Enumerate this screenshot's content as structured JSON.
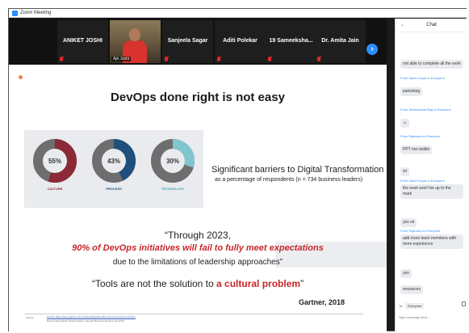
{
  "window": {
    "title": "Zoom Meeting"
  },
  "gallery": {
    "participants": [
      {
        "name": "ANIKET JOSHI"
      },
      {
        "name": "",
        "video_label": "Ajit Joshi"
      },
      {
        "name": "Sanjeela Sagar"
      },
      {
        "name": "Aditi Polekar"
      },
      {
        "name": "19  Sameeksha..."
      },
      {
        "name": "Dr. Amita Jain"
      }
    ],
    "next_glyph": "›"
  },
  "slide": {
    "title": "DevOps done right is not easy",
    "donuts": [
      {
        "label": "CULTURE",
        "value": 55,
        "color": "#8b2a36",
        "label_color": "#8b2a36"
      },
      {
        "label": "PROCESS",
        "value": 43,
        "color": "#1f4f7a",
        "label_color": "#1f4f7a"
      },
      {
        "label": "TECHNOLOGY",
        "value": 30,
        "color": "#7fc6cf",
        "label_color": "#3ba6b4"
      }
    ],
    "barriers_title": "Significant barriers to Digital Transformation",
    "barriers_subtitle": "as a percentage of respondents (n = 734 business leaders)",
    "quote_line1": "“Through 2023,",
    "quote_line2": "90% of DevOps initiatives will fail to fully meet expectations",
    "quote_line3": "due to the limitations of leadership approaches”",
    "quote_line4_plain": "“Tools are not the solution to ",
    "quote_line4_red": "a cultural problem",
    "quote_line4_end": "”",
    "attribution": "Gartner, 2018",
    "source_label": "Source",
    "source_link": "Gartner https://www.gartner.com/smarterwithgartner/the-secret-to-devops-success/",
    "source_text": "Reinventing Digital Transformation, Harvard Business Review July 2018"
  },
  "chat": {
    "title": "Chat",
    "messages": [
      {
        "from": "",
        "text": "not able to complete all the work"
      },
      {
        "from": "From Salee Goyal to Everyone",
        "text": "panicking"
      },
      {
        "from": "From Shubhankar Bag to Everyone",
        "text": "☺"
      },
      {
        "from": "From Rajendra to Everyone",
        "text": "PPT not visible"
      },
      {
        "from": "",
        "text": "sir"
      },
      {
        "from": "From Salee Goyal to Everyone",
        "text": "the work won't be up to the mark"
      },
      {
        "from": "",
        "text": "yes sir"
      },
      {
        "from": "From Rajendra to Everyone",
        "text": "add more team members with more experience"
      },
      {
        "from": "",
        "text": "yes"
      },
      {
        "from": "",
        "text": "resources"
      }
    ],
    "to_label": "To:",
    "to_value": "Everyone",
    "input_placeholder": "Type message here..."
  }
}
